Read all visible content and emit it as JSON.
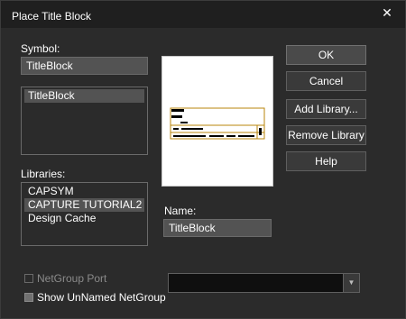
{
  "window": {
    "title": "Place Title Block",
    "close_glyph": "✕"
  },
  "symbol": {
    "label": "Symbol:",
    "value": "TitleBlock",
    "list": [
      "TitleBlock"
    ]
  },
  "libraries": {
    "label": "Libraries:",
    "items": [
      "CAPSYM",
      "CAPTURE TUTORIAL2",
      "Design Cache"
    ]
  },
  "name": {
    "label": "Name:",
    "value": "TitleBlock"
  },
  "buttons": {
    "ok": "OK",
    "cancel": "Cancel",
    "add_library": "Add Library...",
    "remove_library": "Remove Library",
    "help": "Help"
  },
  "options": {
    "netgroup_port": "NetGroup Port",
    "show_unnamed_netgroup": "Show UnNamed NetGroup"
  },
  "combo": {
    "value": "",
    "arrow_glyph": "▼"
  },
  "colors": {
    "background": "#2b2b2b",
    "titlebar": "#1f1f1f",
    "field": "#535353",
    "preview_line": "#b8860b"
  }
}
